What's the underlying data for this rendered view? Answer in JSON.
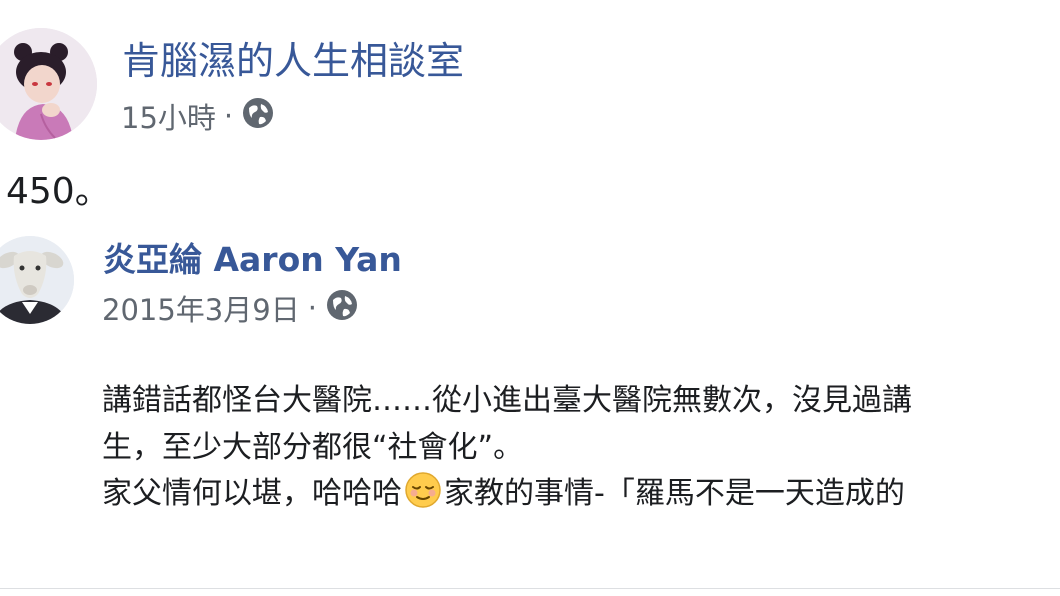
{
  "post1": {
    "author": "肯腦濕的人生相談室",
    "timestamp": "15小時",
    "separator": "·",
    "privacy_icon": "globe-icon",
    "text": "450。"
  },
  "post2": {
    "author": "炎亞綸 Aaron Yan",
    "timestamp": "2015年3月9日",
    "separator": "·",
    "privacy_icon": "globe-icon",
    "line1": "講錯話都怪台大醫院……從小進出臺大醫院無數次，沒見過講",
    "line2": "生，至少大部分都很“社會化”。",
    "line3_before": "家父情何以堪，哈哈哈",
    "line3_emoji": "relieved-face-emoji",
    "line3_after": "家教的事情-「羅馬不是一天造成的"
  },
  "colors": {
    "link": "#385898",
    "meta": "#606770",
    "text": "#1c1e21"
  }
}
